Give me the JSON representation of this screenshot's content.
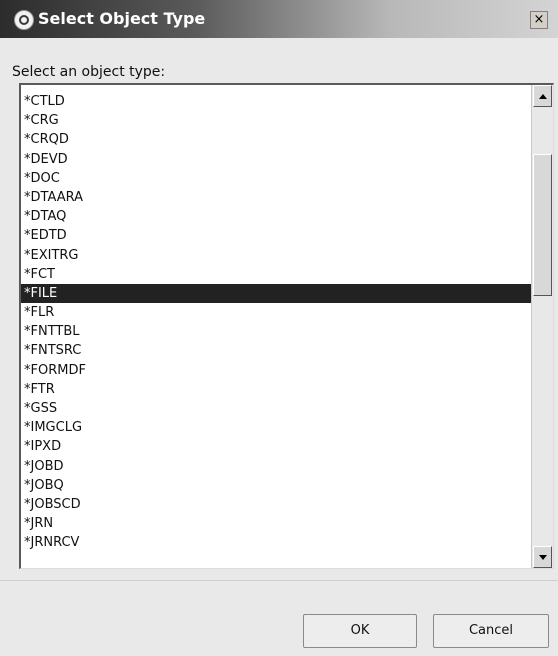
{
  "window": {
    "title": "Select Object Type",
    "close_label": "×"
  },
  "prompt": "Select an object type:",
  "list": {
    "items": [
      "*CTLD",
      "*CRG",
      "*CRQD",
      "*DEVD",
      "*DOC",
      "*DTAARA",
      "*DTAQ",
      "*EDTD",
      "*EXITRG",
      "*FCT",
      "*FILE",
      "*FLR",
      "*FNTTBL",
      "*FNTSRC",
      "*FORMDF",
      "*FTR",
      "*GSS",
      "*IMGCLG",
      "*IPXD",
      "*JOBD",
      "*JOBQ",
      "*JOBSCD",
      "*JRN",
      "*JRNRCV"
    ],
    "selected_index": 10
  },
  "buttons": {
    "ok_label": "OK",
    "cancel_label": "Cancel"
  },
  "colors": {
    "selection_bg": "#222222",
    "selection_fg": "#ffffff"
  }
}
